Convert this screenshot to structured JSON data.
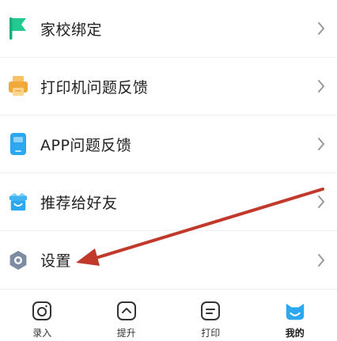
{
  "menu": {
    "items": [
      {
        "label": "家校绑定",
        "icon": "green-flag-icon"
      },
      {
        "label": "打印机问题反馈",
        "icon": "printer-icon"
      },
      {
        "label": "APP问题反馈",
        "icon": "phone-icon"
      },
      {
        "label": "推荐给好友",
        "icon": "gift-box-icon"
      },
      {
        "label": "设置",
        "icon": "gear-icon"
      }
    ]
  },
  "tabbar": {
    "tabs": [
      {
        "label": "录入",
        "icon": "camera-icon",
        "active": false
      },
      {
        "label": "提升",
        "icon": "up-arrow-icon",
        "active": false
      },
      {
        "label": "打印",
        "icon": "print-icon",
        "active": false
      },
      {
        "label": "我的",
        "icon": "cat-face-icon",
        "active": true
      }
    ]
  },
  "colors": {
    "accent_blue": "#2ba8f0",
    "flag_green": "#1dbf8a",
    "printer_orange": "#f2a93b",
    "gear_gray": "#7d8ca3",
    "arrow_red": "#c0392b",
    "chevron_gray": "#9a9a9a"
  }
}
